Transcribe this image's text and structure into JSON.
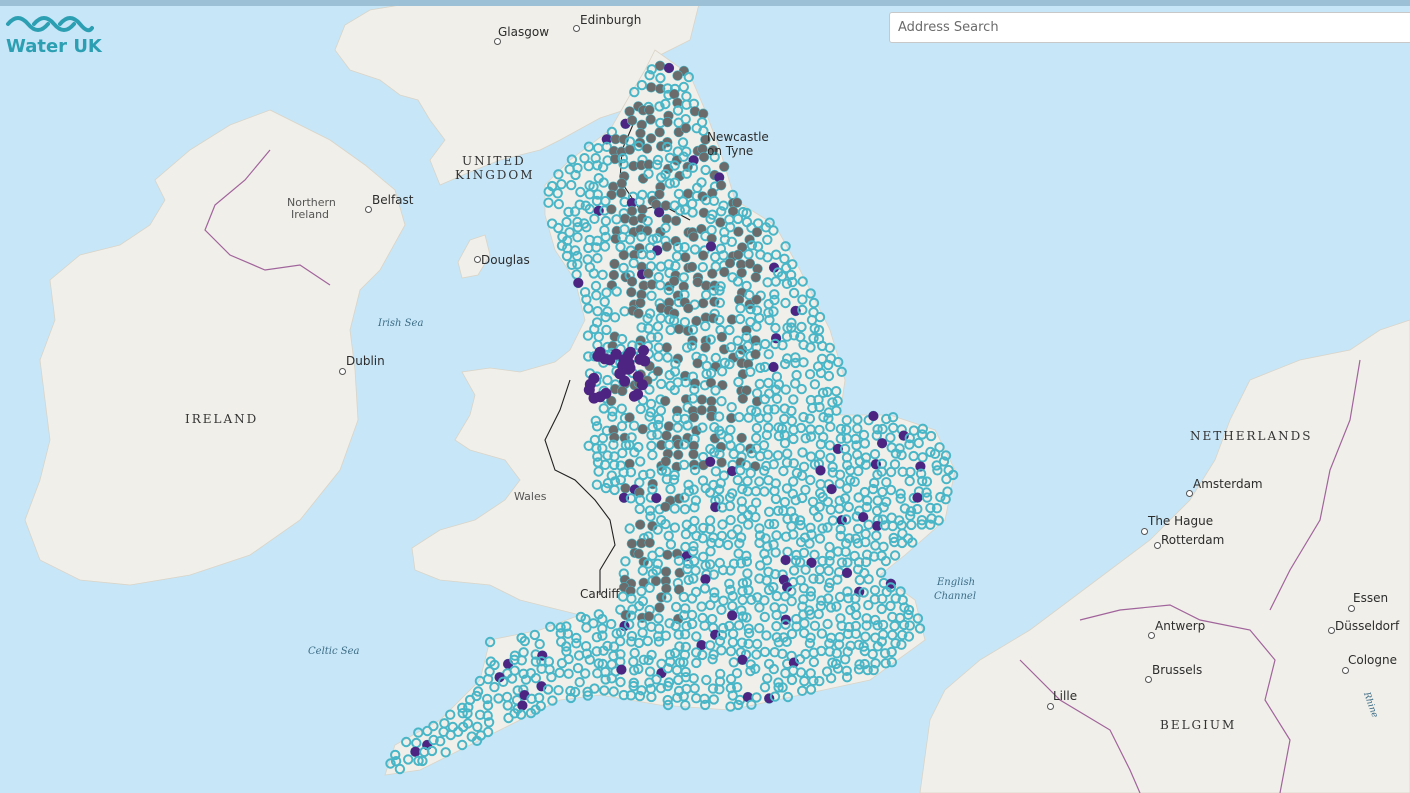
{
  "app": {
    "logo_text": "Water UK"
  },
  "search": {
    "placeholder": "Address Search"
  },
  "colors": {
    "sea": "#c7e6f7",
    "land": "#f1efe9",
    "site_teal": "#49b6c7",
    "site_grey": "#6b6b6b",
    "site_purple": "#4e2482",
    "logo": "#2d9fb3"
  },
  "labels": {
    "glasgow": "Glasgow",
    "edinburgh": "Edinburgh",
    "newcastle_1": "Newcastle",
    "newcastle_2": "on Tyne",
    "united_kingdom_1": "UNITED",
    "united_kingdom_2": "KINGDOM",
    "northern_ireland_1": "Northern",
    "northern_ireland_2": "Ireland",
    "belfast": "Belfast",
    "douglas": "Douglas",
    "irish_sea": "Irish Sea",
    "dublin": "Dublin",
    "ireland": "IRELAND",
    "wales": "Wales",
    "cardiff": "Cardiff",
    "celtic_sea": "Celtic Sea",
    "english_channel_1": "English",
    "english_channel_2": "Channel",
    "netherlands": "NETHERLANDS",
    "amsterdam": "Amsterdam",
    "the_hague": "The Hague",
    "rotterdam": "Rotterdam",
    "essen": "Essen",
    "antwerp": "Antwerp",
    "dusseldorf": "Düsseldorf",
    "brussels": "Brussels",
    "cologne": "Cologne",
    "lille": "Lille",
    "belgium": "BELGIUM",
    "rhine": "Rhine"
  }
}
